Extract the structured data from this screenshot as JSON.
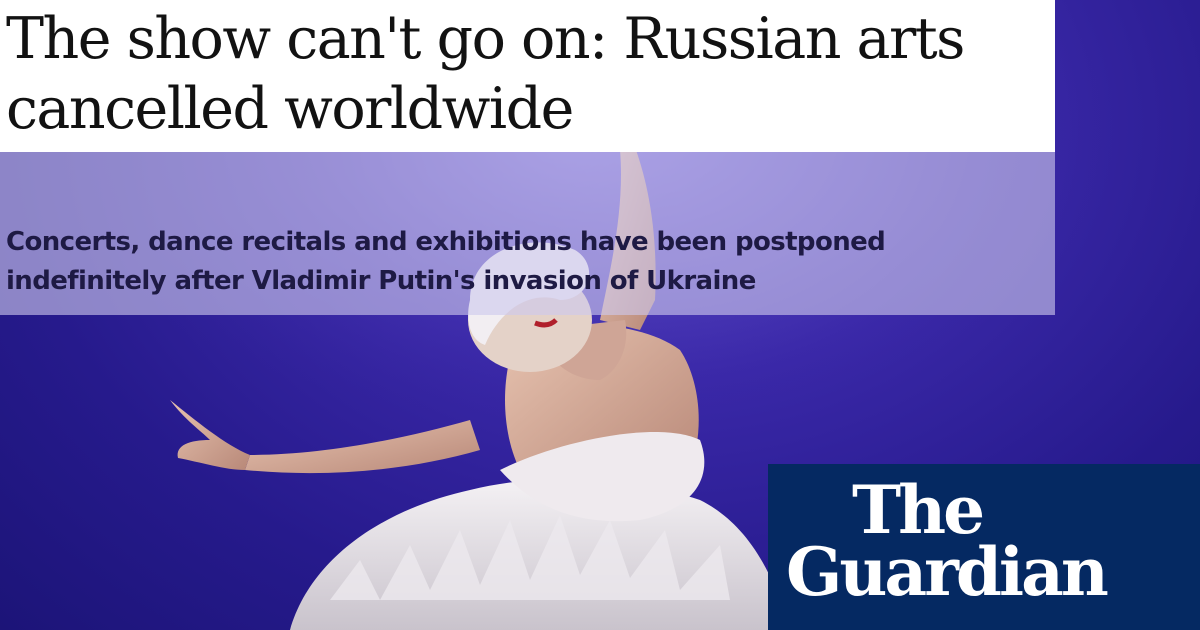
{
  "article": {
    "headline": "The show can't go on: Russian arts cancelled worldwide",
    "standfirst": "Concerts, dance recitals and exhibitions have been postponed indefinitely after Vladimir Putin's invasion of Ukraine"
  },
  "brand": {
    "logo_line1": "The",
    "logo_line2": "Guardian"
  },
  "colors": {
    "background": "#261a8c",
    "headline_panel": "#ffffff",
    "standfirst_panel": "#cdc8ee",
    "logo_panel": "#052962",
    "logo_text": "#ffffff"
  },
  "image": {
    "subject": "ballet-dancer-in-white-feathered-swan-costume"
  }
}
